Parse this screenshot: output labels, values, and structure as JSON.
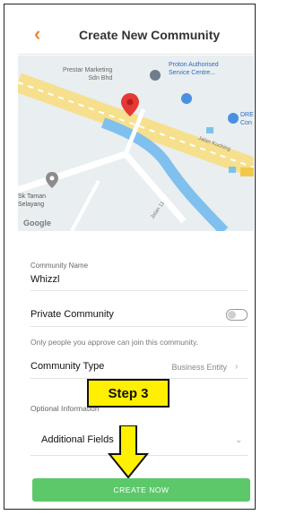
{
  "header": {
    "back_icon": "chevron-left-icon",
    "title": "Create New Community"
  },
  "map": {
    "labels": {
      "place1": "Prestar Marketing",
      "place1b": "Sdn Bhd",
      "place2": "Proton Authorised",
      "place2b": "Service Centre...",
      "place3": "DRE",
      "place3b": "Con",
      "road1": "Jalan Kuching",
      "road2": "Jalan 11",
      "area1": "Sk Taman",
      "area2": "Selayang",
      "google": "Google"
    }
  },
  "form": {
    "community_name_label": "Community Name",
    "community_name_value": "Whizzl",
    "private_label": "Private Community",
    "private_note": "Only people you approve can join this community.",
    "type_label": "Community Type",
    "type_value": "Business Entity",
    "optional_label": "Optional Information",
    "additional_label": "Additional Fields"
  },
  "overlay": {
    "step_label": "Step 3"
  },
  "actions": {
    "create_label": "CREATE NOW"
  },
  "colors": {
    "accent": "#f28a2e",
    "create_button": "#5dc86a",
    "step_box": "#ffef00"
  }
}
